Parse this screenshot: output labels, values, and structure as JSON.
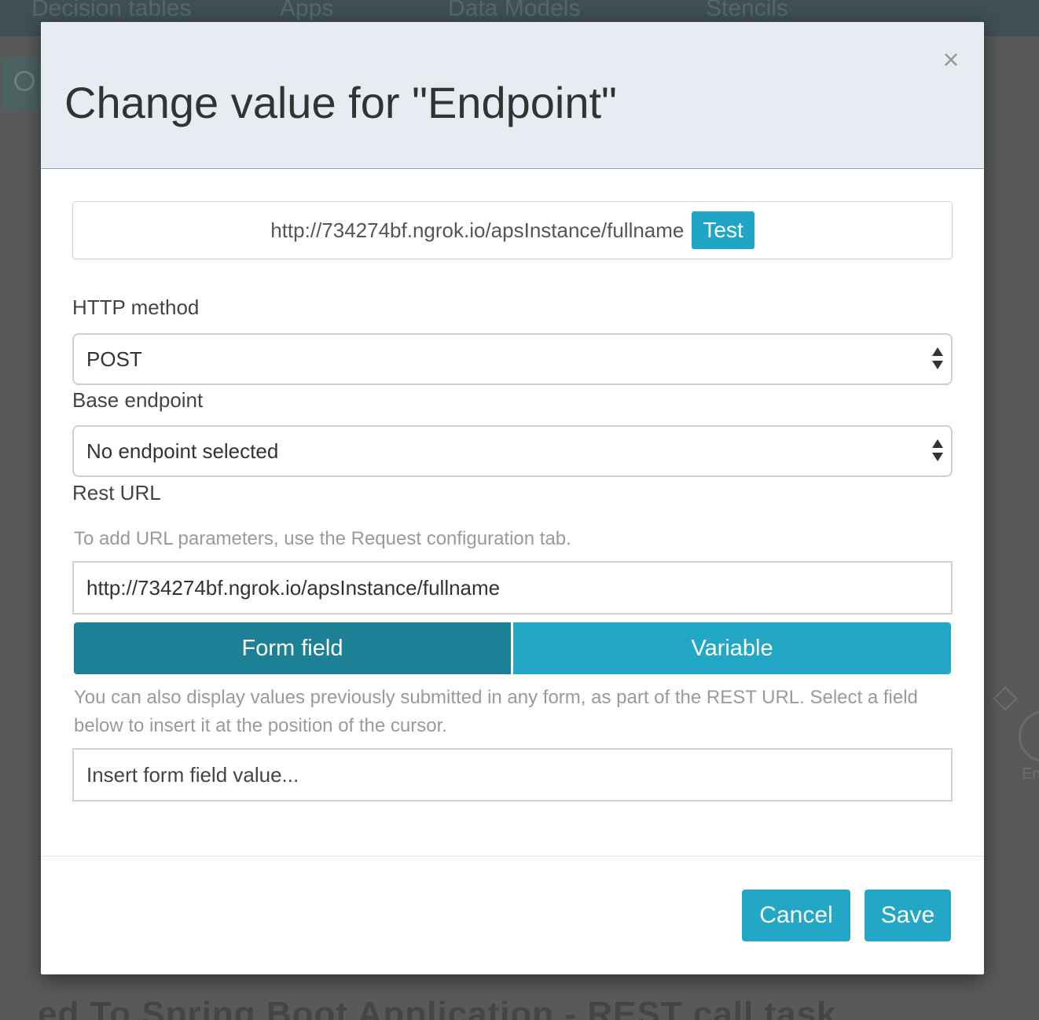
{
  "background": {
    "nav_items": [
      "Decision tables",
      "Apps",
      "Data Models",
      "Stencils"
    ],
    "bottom_title": "ed To Spring Boot Application - REST call task",
    "right_fragment": "En"
  },
  "modal": {
    "title": "Change value for \"Endpoint\"",
    "close_glyph": "×",
    "preview": {
      "url": "http://734274bf.ngrok.io/apsInstance/fullname",
      "test_label": "Test"
    },
    "http_method": {
      "label": "HTTP method",
      "value": "POST"
    },
    "base_endpoint": {
      "label": "Base endpoint",
      "value": "No endpoint selected"
    },
    "rest_url": {
      "label": "Rest URL",
      "help": "To add URL parameters, use the Request configuration tab.",
      "value": "http://734274bf.ngrok.io/apsInstance/fullname"
    },
    "tabs": [
      {
        "label": "Form field",
        "active": true
      },
      {
        "label": "Variable",
        "active": false
      }
    ],
    "form_field_help": "You can also display values previously submitted in any form, as part of the REST URL. Select a field below to insert it at the position of the cursor.",
    "insert_placeholder": "Insert form field value...",
    "footer": {
      "cancel_label": "Cancel",
      "save_label": "Save"
    }
  },
  "colors": {
    "accent": "#22a8c6",
    "accent_dark": "#1c8096",
    "header_bg": "#e6ecf1"
  }
}
